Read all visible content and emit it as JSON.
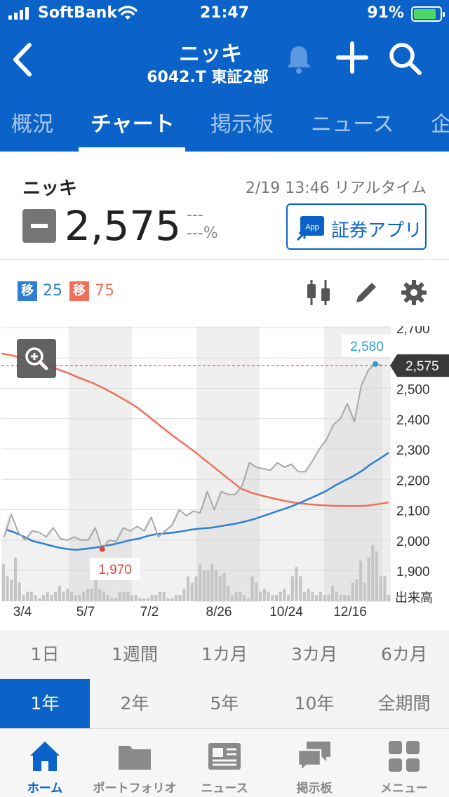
{
  "status_bar": {
    "carrier": "SoftBank",
    "time": "21:47",
    "battery": "91%",
    "battery_level": 0.91
  },
  "header": {
    "title": "ニッキ",
    "subtitle": "6042.T 東証2部"
  },
  "tabs": [
    {
      "label": "概況"
    },
    {
      "label": "チャート",
      "active": true
    },
    {
      "label": "掲示板"
    },
    {
      "label": "ニュース"
    },
    {
      "label": "企"
    }
  ],
  "quote": {
    "name": "ニッキ",
    "timestamp": "2/19 13:46 リアルタイム",
    "price": "2,575",
    "change": "---",
    "change_pct": "---%",
    "app_button": "証券アプリ",
    "app_icon_text": "App"
  },
  "moving_averages": [
    {
      "badge": "移",
      "value": "25",
      "color": "#2f7fd0"
    },
    {
      "badge": "移",
      "value": "75",
      "color": "#f0705a"
    }
  ],
  "chart_data": {
    "type": "line",
    "x_tick_labels": [
      "3/4",
      "5/7",
      "7/2",
      "8/26",
      "10/24",
      "12/16"
    ],
    "y_tick_labels": [
      "2,700",
      "2,600",
      "2,500",
      "2,400",
      "2,300",
      "2,200",
      "2,100",
      "2,000",
      "1,900"
    ],
    "ylim": [
      1900,
      2700
    ],
    "volume_label": "出来高",
    "current_price_label": "2,575",
    "current_price": 2575,
    "max_label": "2,580",
    "min_label": "1,970",
    "colors": {
      "price": "#a8a8a8",
      "ma25": "#2f7fd0",
      "ma75": "#f0705a",
      "volume": "#c4c4c4",
      "min": "#e0443a",
      "max": "#2a9fd6"
    },
    "series": [
      {
        "name": "price",
        "values": [
          2010,
          2085,
          2025,
          2000,
          2030,
          2025,
          2010,
          2040,
          2005,
          2000,
          2010,
          2000,
          2000,
          2040,
          1970,
          2000,
          1995,
          2040,
          2030,
          2045,
          2030,
          2075,
          2010,
          2030,
          2050,
          2100,
          2080,
          2095,
          2090,
          2160,
          2100,
          2160,
          2150,
          2150,
          2180,
          2255,
          2240,
          2235,
          2230,
          2255,
          2240,
          2250,
          2225,
          2225,
          2260,
          2300,
          2330,
          2380,
          2400,
          2450,
          2390,
          2510,
          2560,
          2580,
          2575
        ]
      },
      {
        "name": "MA25",
        "values": [
          2035,
          2025,
          2012,
          1997,
          1990,
          1982,
          1975,
          1970,
          1968,
          1971,
          1975,
          1980,
          1985,
          1992,
          2000,
          2005,
          2014,
          2020,
          2022,
          2025,
          2030,
          2035,
          2038,
          2040,
          2045,
          2050,
          2055,
          2062,
          2070,
          2080,
          2090,
          2100,
          2110,
          2122,
          2135,
          2148,
          2162,
          2180,
          2195,
          2210,
          2228,
          2250,
          2268,
          2288
        ]
      },
      {
        "name": "MA75",
        "values": [
          2615,
          2608,
          2598,
          2588,
          2575,
          2562,
          2548,
          2532,
          2518,
          2500,
          2480,
          2458,
          2435,
          2405,
          2375,
          2345,
          2318,
          2290,
          2260,
          2230,
          2200,
          2170,
          2155,
          2145,
          2136,
          2128,
          2122,
          2118,
          2115,
          2113,
          2112,
          2112,
          2113,
          2118,
          2124
        ]
      }
    ],
    "volume": [
      12,
      8,
      7,
      14,
      6,
      2,
      3,
      3,
      2,
      1,
      2,
      3,
      2,
      3,
      5,
      3,
      4,
      3,
      2,
      2,
      3,
      4,
      4,
      8,
      4,
      3,
      2,
      1,
      1,
      3,
      3,
      3,
      2,
      2,
      1,
      1,
      1,
      2,
      2,
      3,
      3,
      1,
      1,
      2,
      2,
      4,
      8,
      6,
      8,
      12,
      10,
      10,
      12,
      10,
      8,
      9,
      5,
      2,
      3,
      3,
      2,
      1,
      8,
      6,
      3,
      4,
      3,
      2,
      2,
      3,
      4,
      2,
      8,
      11,
      8,
      3,
      4,
      3,
      2,
      3,
      2,
      2,
      5,
      3,
      2,
      2,
      2,
      6,
      7,
      13,
      6,
      14,
      18,
      16,
      8,
      8,
      2
    ]
  },
  "ranges": [
    {
      "label": "1日"
    },
    {
      "label": "1週間"
    },
    {
      "label": "1カ月"
    },
    {
      "label": "3カ月"
    },
    {
      "label": "6カ月"
    },
    {
      "label": "1年",
      "active": true
    },
    {
      "label": "2年"
    },
    {
      "label": "5年"
    },
    {
      "label": "10年"
    },
    {
      "label": "全期間"
    }
  ],
  "bottom_nav": [
    {
      "label": "ホーム",
      "icon": "home-icon",
      "active": true
    },
    {
      "label": "ポートフォリオ",
      "icon": "folder-icon"
    },
    {
      "label": "ニュース",
      "icon": "newspaper-icon"
    },
    {
      "label": "掲示板",
      "icon": "chat-bubbles-icon"
    },
    {
      "label": "メニュー",
      "icon": "grid-menu-icon"
    }
  ]
}
